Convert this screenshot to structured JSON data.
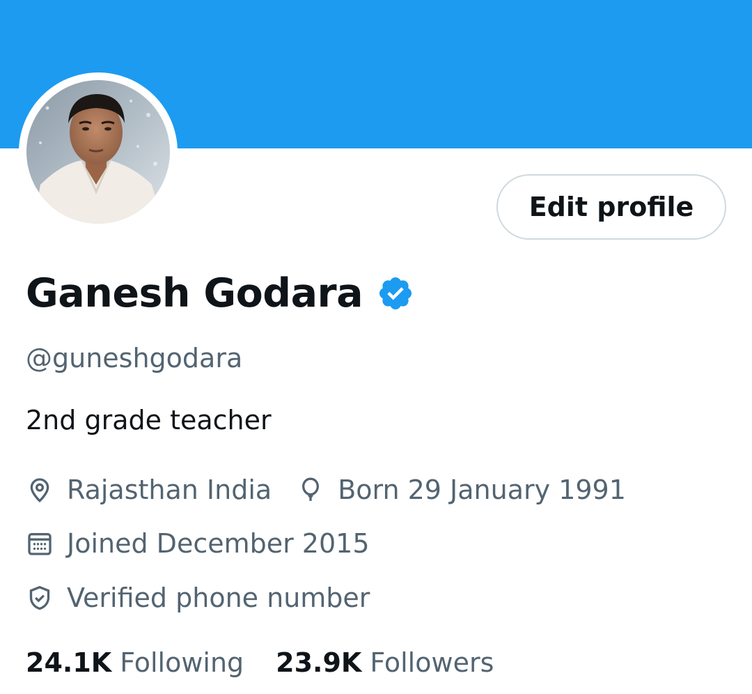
{
  "profile": {
    "banner_color": "#1d9bf0",
    "accent_color": "#1d9bf0",
    "name": "Ganesh Godara",
    "verified": true,
    "handle": "@guneshgodara",
    "bio": "2nd grade teacher",
    "edit_button_label": "Edit profile",
    "location": "Rajasthan India",
    "birthday": "Born 29 January 1991",
    "joined": "Joined December 2015",
    "verified_phone": "Verified phone number",
    "stats": {
      "following_count": "24.1K",
      "following_label": "Following",
      "followers_count": "23.9K",
      "followers_label": "Followers"
    },
    "icons": {
      "location": "location-pin-icon",
      "birthday": "balloon-icon",
      "joined": "calendar-icon",
      "verified_phone": "shield-check-icon",
      "verified_badge": "verified-badge-icon"
    }
  }
}
